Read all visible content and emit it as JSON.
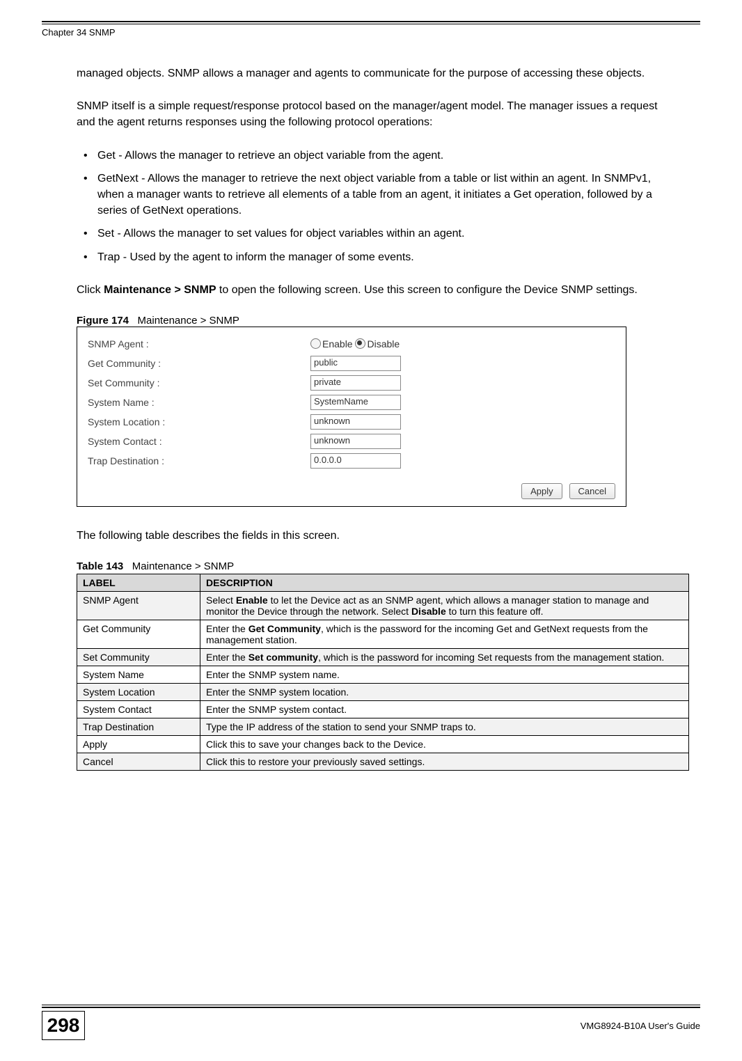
{
  "header": {
    "chapter": "Chapter 34 SNMP"
  },
  "paragraphs": {
    "p1": "managed objects. SNMP allows a manager and agents to communicate for the purpose of accessing these objects.",
    "p2": "SNMP itself is a simple request/response protocol based on the manager/agent model. The manager issues a request and the agent returns responses using the following protocol operations:",
    "p3_pre": "Click ",
    "p3_bold": "Maintenance > SNMP",
    "p3_post": " to open the following screen. Use this screen to configure the Device SNMP settings.",
    "p4": "The following table describes the fields in this screen."
  },
  "bullets": [
    "Get - Allows the manager to retrieve an object variable from the agent.",
    "GetNext - Allows the manager to retrieve the next object variable from a table or list within an agent. In SNMPv1, when a manager wants to retrieve all elements of a table from an agent, it initiates a Get operation, followed by a series of GetNext operations.",
    "Set - Allows the manager to set values for object variables within an agent.",
    "Trap - Used by the agent to inform the manager of some events."
  ],
  "figure": {
    "label": "Figure 174",
    "caption": "Maintenance > SNMP",
    "rows": {
      "snmp_agent_label": "SNMP Agent :",
      "enable": "Enable",
      "disable": "Disable",
      "get_community_label": "Get Community :",
      "get_community_value": "public",
      "set_community_label": "Set Community :",
      "set_community_value": "private",
      "system_name_label": "System Name :",
      "system_name_value": "SystemName",
      "system_location_label": "System Location :",
      "system_location_value": "unknown",
      "system_contact_label": "System Contact :",
      "system_contact_value": "unknown",
      "trap_destination_label": "Trap Destination :",
      "trap_destination_value": "0.0.0.0"
    },
    "buttons": {
      "apply": "Apply",
      "cancel": "Cancel"
    }
  },
  "table": {
    "label": "Table 143",
    "caption": "Maintenance > SNMP",
    "headers": {
      "label": "LABEL",
      "description": "DESCRIPTION"
    },
    "rows": [
      {
        "label": "SNMP Agent",
        "desc_pre": "Select ",
        "desc_b1": "Enable",
        "desc_mid": " to let the Device act as an SNMP agent, which allows a manager station to manage and monitor the Device through the network. Select ",
        "desc_b2": "Disable",
        "desc_post": " to turn this feature off."
      },
      {
        "label": "Get Community",
        "desc_pre": "Enter the ",
        "desc_b1": "Get Community",
        "desc_mid": ", which is the password for the incoming Get and GetNext requests from the management station.",
        "desc_b2": "",
        "desc_post": ""
      },
      {
        "label": "Set Community",
        "desc_pre": "Enter the ",
        "desc_b1": "Set community",
        "desc_mid": ", which is the password for incoming Set requests from the management station.",
        "desc_b2": "",
        "desc_post": ""
      },
      {
        "label": "System Name",
        "desc_plain": "Enter the SNMP system name."
      },
      {
        "label": "System Location",
        "desc_plain": "Enter the SNMP system location."
      },
      {
        "label": "System Contact",
        "desc_plain": "Enter the SNMP system contact."
      },
      {
        "label": "Trap Destination",
        "desc_plain": "Type the IP address of the station to send your SNMP traps to."
      },
      {
        "label": "Apply",
        "desc_plain": "Click this to save your changes back to the Device."
      },
      {
        "label": "Cancel",
        "desc_plain": "Click this to restore your previously saved settings."
      }
    ]
  },
  "footer": {
    "page": "298",
    "guide": "VMG8924-B10A User's Guide"
  }
}
